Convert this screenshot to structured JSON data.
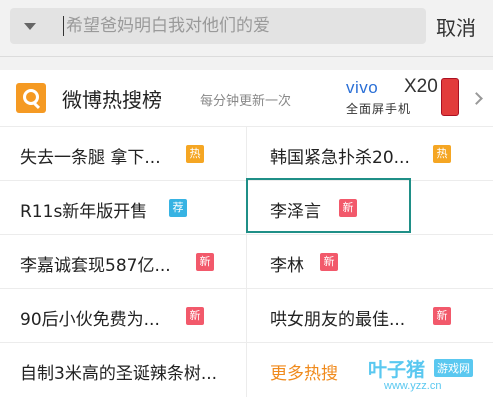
{
  "search": {
    "placeholder": "希望爸妈明白我对他们的爱",
    "value": "",
    "cancel_label": "取消"
  },
  "hot_search": {
    "title": "微博热搜榜",
    "subtitle": "每分钟更新一次",
    "ad": {
      "brand": "vivo",
      "model": "X20",
      "slogan": "全面屏手机"
    },
    "items": [
      {
        "text": "失去一条腿 拿下...",
        "badge": "热",
        "badge_type": "hot"
      },
      {
        "text": "韩国紧急扑杀20...",
        "badge": "热",
        "badge_type": "hot"
      },
      {
        "text": "R11s新年版开售",
        "badge": "荐",
        "badge_type": "rec"
      },
      {
        "text": "李泽言",
        "badge": "新",
        "badge_type": "new"
      },
      {
        "text": "李嘉诚套现587亿...",
        "badge": "新",
        "badge_type": "new"
      },
      {
        "text": "李林",
        "badge": "新",
        "badge_type": "new"
      },
      {
        "text": "90后小伙免费为...",
        "badge": "新",
        "badge_type": "new"
      },
      {
        "text": "哄女朋友的最佳...",
        "badge": "新",
        "badge_type": "new"
      },
      {
        "text": "自制3米高的圣诞辣条树...",
        "badge": "",
        "badge_type": ""
      },
      {
        "text": "更多热搜",
        "badge": "",
        "badge_type": "more"
      }
    ]
  },
  "watermark": {
    "name": "叶子猪",
    "tag": "游戏网",
    "url": "www.yzz.cn"
  },
  "colors": {
    "accent": "#f08a1c",
    "hot": "#f5a623",
    "new": "#f2596b",
    "recommend": "#37b3e3",
    "selection": "#1f8f87"
  }
}
